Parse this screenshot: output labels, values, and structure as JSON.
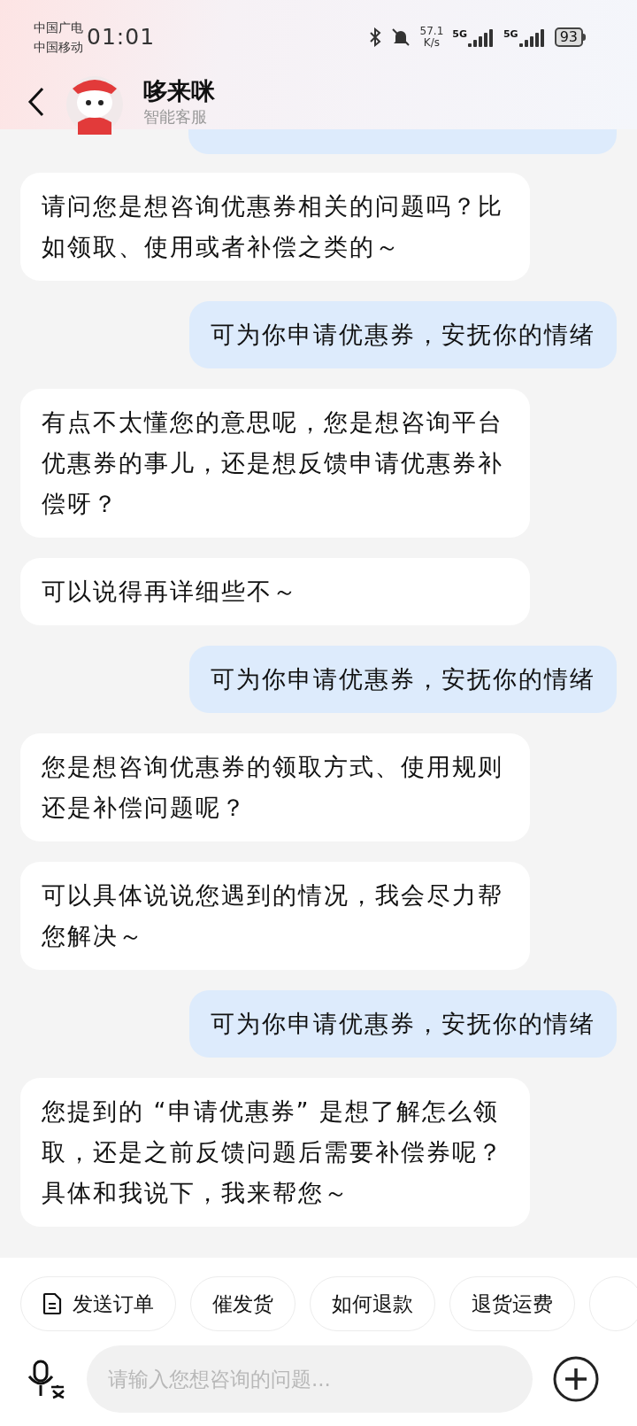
{
  "status_bar": {
    "carriers": [
      "中国广电",
      "中国移动"
    ],
    "time": "01:01",
    "speed_value": "57.1",
    "speed_unit": "K/s",
    "sims": [
      "5G",
      "5G"
    ],
    "battery": "93"
  },
  "header": {
    "name": "哆来咪",
    "subtitle": "智能客服"
  },
  "messages": [
    {
      "kind": "bot",
      "text": "请问您是想咨询优惠券相关的问题吗？比如领取、使用或者补偿之类的～"
    },
    {
      "kind": "user",
      "text": "可为你申请优惠券，安抚你的情绪"
    },
    {
      "kind": "bot",
      "text": "有点不太懂您的意思呢，您是想咨询平台优惠券的事儿，还是想反馈申请优惠券补偿呀？"
    },
    {
      "kind": "bot",
      "text": "可以说得再详细些不～"
    },
    {
      "kind": "user",
      "text": "可为你申请优惠券，安抚你的情绪"
    },
    {
      "kind": "bot",
      "text": "您是想咨询优惠券的领取方式、使用规则还是补偿问题呢？"
    },
    {
      "kind": "bot",
      "text": "可以具体说说您遇到的情况，我会尽力帮您解决～"
    },
    {
      "kind": "user",
      "text": "可为你申请优惠券，安抚你的情绪"
    },
    {
      "kind": "bot",
      "text": "您提到的 “申请优惠券” 是想了解怎么领取，还是之前反馈问题后需要补偿券呢？具体和我说下，我来帮您～"
    }
  ],
  "quick_replies": [
    {
      "label": "发送订单",
      "kind": "order"
    },
    {
      "label": "催发货",
      "kind": "plain"
    },
    {
      "label": "如何退款",
      "kind": "plain"
    },
    {
      "label": "退货运费",
      "kind": "plain"
    }
  ],
  "input": {
    "placeholder": "请输入您想咨询的问题..."
  }
}
